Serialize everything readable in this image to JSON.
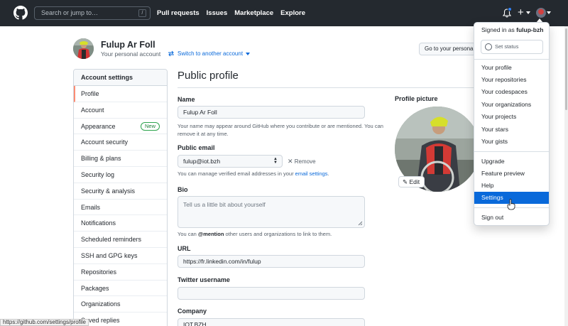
{
  "header": {
    "search_placeholder": "Search or jump to…",
    "search_key": "/",
    "nav": [
      "Pull requests",
      "Issues",
      "Marketplace",
      "Explore"
    ],
    "plus_label": "+"
  },
  "user": {
    "name": "Fulup Ar Foll",
    "subtitle": "Your personal account",
    "switch_label": "Switch to another account",
    "goto_label": "Go to your personal profile"
  },
  "sidebar": {
    "heading": "Account settings",
    "items": [
      {
        "label": "Profile"
      },
      {
        "label": "Account"
      },
      {
        "label": "Appearance",
        "badge": "New"
      },
      {
        "label": "Account security"
      },
      {
        "label": "Billing & plans"
      },
      {
        "label": "Security log"
      },
      {
        "label": "Security & analysis"
      },
      {
        "label": "Emails"
      },
      {
        "label": "Notifications"
      },
      {
        "label": "Scheduled reminders"
      },
      {
        "label": "SSH and GPG keys"
      },
      {
        "label": "Repositories"
      },
      {
        "label": "Packages"
      },
      {
        "label": "Organizations"
      },
      {
        "label": "Saved replies"
      }
    ]
  },
  "main": {
    "title": "Public profile",
    "name_label": "Name",
    "name_value": "Fulup Ar Foll",
    "name_note": "Your name may appear around GitHub where you contribute or are mentioned. You can remove it at any time.",
    "email_label": "Public email",
    "email_value": "fulup@iot.bzh",
    "remove_label": "Remove",
    "email_note_pre": "You can manage verified email addresses in your ",
    "email_note_link": "email settings",
    "email_note_post": ".",
    "bio_label": "Bio",
    "bio_placeholder": "Tell us a little bit about yourself",
    "bio_note_pre": "You can ",
    "bio_note_mention": "@mention",
    "bio_note_post": " other users and organizations to link to them.",
    "url_label": "URL",
    "url_value": "https://fr.linkedin.com/in/fulup",
    "twitter_label": "Twitter username",
    "twitter_value": "",
    "company_label": "Company",
    "company_value": "IOT.BZH",
    "picture_label": "Profile picture",
    "edit_label": "Edit"
  },
  "dropdown": {
    "signed_prefix": "Signed in as ",
    "username": "fulup-bzh",
    "set_status": "Set status",
    "group1": [
      "Your profile",
      "Your repositories",
      "Your codespaces",
      "Your organizations",
      "Your projects",
      "Your stars",
      "Your gists"
    ],
    "group2": [
      "Upgrade",
      "Feature preview",
      "Help",
      "Settings"
    ],
    "signout": "Sign out"
  },
  "statusbar": {
    "url": "https://github.com/settings/profile"
  },
  "colors": {
    "header_bg": "#24292f",
    "accent_blue": "#0969da",
    "selected_border": "#fd8c73",
    "new_badge": "#1a7f37"
  }
}
